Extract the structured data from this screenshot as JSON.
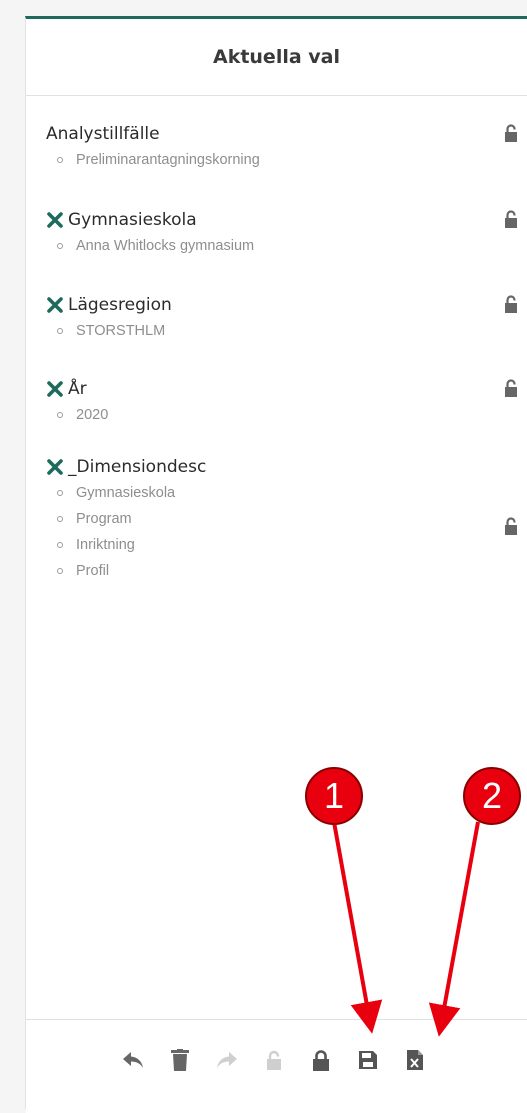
{
  "panel": {
    "title": "Aktuella val",
    "accent": "#1e6a5c"
  },
  "selections": [
    {
      "title": "Analystillfälle",
      "removable": false,
      "values": [
        "Preliminarantagningskorning"
      ]
    },
    {
      "title": "Gymnasieskola",
      "removable": true,
      "values": [
        "Anna Whitlocks gymnasium"
      ]
    },
    {
      "title": "Lägesregion",
      "removable": true,
      "values": [
        "STORSTHLM"
      ]
    },
    {
      "title": "År",
      "removable": true,
      "values": [
        "2020"
      ]
    },
    {
      "title": "_Dimensiondesc",
      "removable": true,
      "values": [
        "Gymnasieskola",
        "Program",
        "Inriktning",
        "Profil"
      ]
    }
  ],
  "icons": {
    "remove": "close-icon",
    "lock": "unlock-icon"
  },
  "toolbar": [
    {
      "name": "back-icon",
      "state": "enabled"
    },
    {
      "name": "trash-icon",
      "state": "enabled"
    },
    {
      "name": "forward-icon",
      "state": "disabled"
    },
    {
      "name": "unlock-icon",
      "state": "disabled"
    },
    {
      "name": "lock-icon",
      "state": "enabled"
    },
    {
      "name": "save-icon",
      "state": "enabled"
    },
    {
      "name": "excel-export-icon",
      "state": "enabled"
    }
  ],
  "callouts": [
    {
      "label": "1",
      "color": "#e8000f"
    },
    {
      "label": "2",
      "color": "#e8000f"
    }
  ]
}
